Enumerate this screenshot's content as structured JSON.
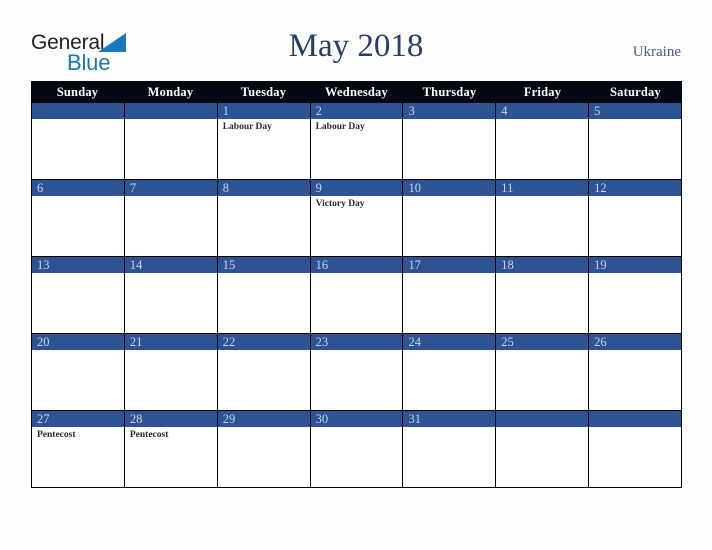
{
  "brand": {
    "name_part1": "General",
    "name_part2": "Blue",
    "triangle_color": "#1878be",
    "text_color": "#231f20"
  },
  "header": {
    "title": "May 2018",
    "country": "Ukraine",
    "title_color": "#27406b",
    "country_color": "#4a5b80"
  },
  "calendar": {
    "accent_color": "#2e5395",
    "header_bg": "#030712",
    "weekdays": [
      "Sunday",
      "Monday",
      "Tuesday",
      "Wednesday",
      "Thursday",
      "Friday",
      "Saturday"
    ],
    "weeks": [
      [
        {
          "day": "",
          "events": []
        },
        {
          "day": "",
          "events": []
        },
        {
          "day": "1",
          "events": [
            "Labour Day"
          ]
        },
        {
          "day": "2",
          "events": [
            "Labour Day"
          ]
        },
        {
          "day": "3",
          "events": []
        },
        {
          "day": "4",
          "events": []
        },
        {
          "day": "5",
          "events": []
        }
      ],
      [
        {
          "day": "6",
          "events": []
        },
        {
          "day": "7",
          "events": []
        },
        {
          "day": "8",
          "events": []
        },
        {
          "day": "9",
          "events": [
            "Victory Day"
          ]
        },
        {
          "day": "10",
          "events": []
        },
        {
          "day": "11",
          "events": []
        },
        {
          "day": "12",
          "events": []
        }
      ],
      [
        {
          "day": "13",
          "events": []
        },
        {
          "day": "14",
          "events": []
        },
        {
          "day": "15",
          "events": []
        },
        {
          "day": "16",
          "events": []
        },
        {
          "day": "17",
          "events": []
        },
        {
          "day": "18",
          "events": []
        },
        {
          "day": "19",
          "events": []
        }
      ],
      [
        {
          "day": "20",
          "events": []
        },
        {
          "day": "21",
          "events": []
        },
        {
          "day": "22",
          "events": []
        },
        {
          "day": "23",
          "events": []
        },
        {
          "day": "24",
          "events": []
        },
        {
          "day": "25",
          "events": []
        },
        {
          "day": "26",
          "events": []
        }
      ],
      [
        {
          "day": "27",
          "events": [
            "Pentecost"
          ]
        },
        {
          "day": "28",
          "events": [
            "Pentecost"
          ]
        },
        {
          "day": "29",
          "events": []
        },
        {
          "day": "30",
          "events": []
        },
        {
          "day": "31",
          "events": []
        },
        {
          "day": "",
          "events": []
        },
        {
          "day": "",
          "events": []
        }
      ]
    ]
  }
}
